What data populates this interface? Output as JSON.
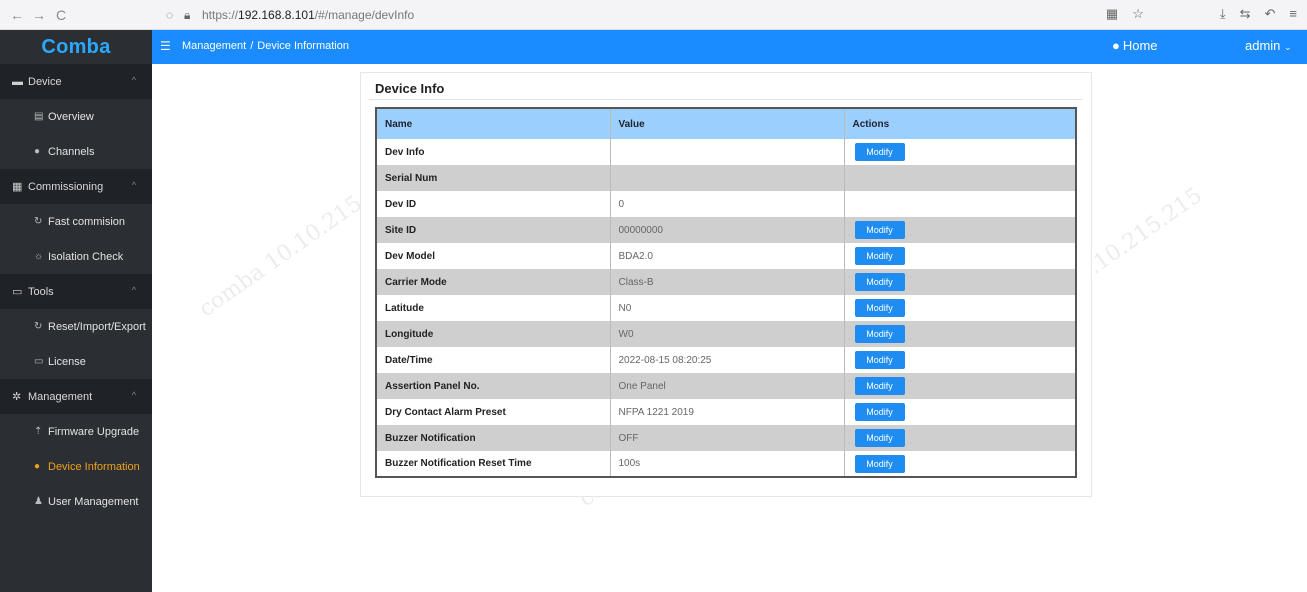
{
  "browser": {
    "back": "←",
    "forward": "→",
    "reload": "C",
    "url_scheme": "https://",
    "url_host": "192.168.8.101",
    "url_path": "/#/manage/devInfo"
  },
  "header": {
    "logo": "Comba",
    "breadcrumb_parent": "Management",
    "breadcrumb_sep": "/",
    "breadcrumb_current": "Device Information",
    "home_label": "Home",
    "admin_label": "admin"
  },
  "sidebar": {
    "groups": [
      {
        "label": "Device",
        "items": [
          "Overview",
          "Channels"
        ]
      },
      {
        "label": "Commissioning",
        "items": [
          "Fast commision",
          "Isolation Check"
        ]
      },
      {
        "label": "Tools",
        "items": [
          "Reset/Import/Export",
          "License"
        ]
      },
      {
        "label": "Management",
        "items": [
          "Firmware Upgrade",
          "Device Information",
          "User Management"
        ]
      }
    ],
    "active": "Device Information"
  },
  "panel": {
    "title": "Device Info",
    "columns": [
      "Name",
      "Value",
      "Actions"
    ],
    "modify_label": "Modify",
    "rows": [
      {
        "name": "Dev Info",
        "value": "",
        "action": true
      },
      {
        "name": "Serial Num",
        "value": "",
        "action": false
      },
      {
        "name": "Dev ID",
        "value": "0",
        "action": false
      },
      {
        "name": "Site ID",
        "value": "00000000",
        "action": true
      },
      {
        "name": "Dev Model",
        "value": "BDA2.0",
        "action": true
      },
      {
        "name": "Carrier Mode",
        "value": "Class-B",
        "action": true
      },
      {
        "name": "Latitude",
        "value": "N0",
        "action": true
      },
      {
        "name": "Longitude",
        "value": "W0",
        "action": true
      },
      {
        "name": "Date/Time",
        "value": "2022-08-15 08:20:25",
        "action": true
      },
      {
        "name": "Assertion Panel No.",
        "value": "One Panel",
        "action": true
      },
      {
        "name": "Dry Contact Alarm Preset",
        "value": "NFPA 1221 2019",
        "action": true
      },
      {
        "name": "Buzzer Notification",
        "value": "OFF",
        "action": true
      },
      {
        "name": "Buzzer Notification Reset Time",
        "value": "100s",
        "action": true
      }
    ]
  },
  "colors": {
    "header_blue": "#1a8cff",
    "sidebar_dark": "#2b2f33",
    "active_orange": "#f0a020",
    "table_header": "#9ad0fb",
    "button_blue": "#1e8cf0"
  }
}
